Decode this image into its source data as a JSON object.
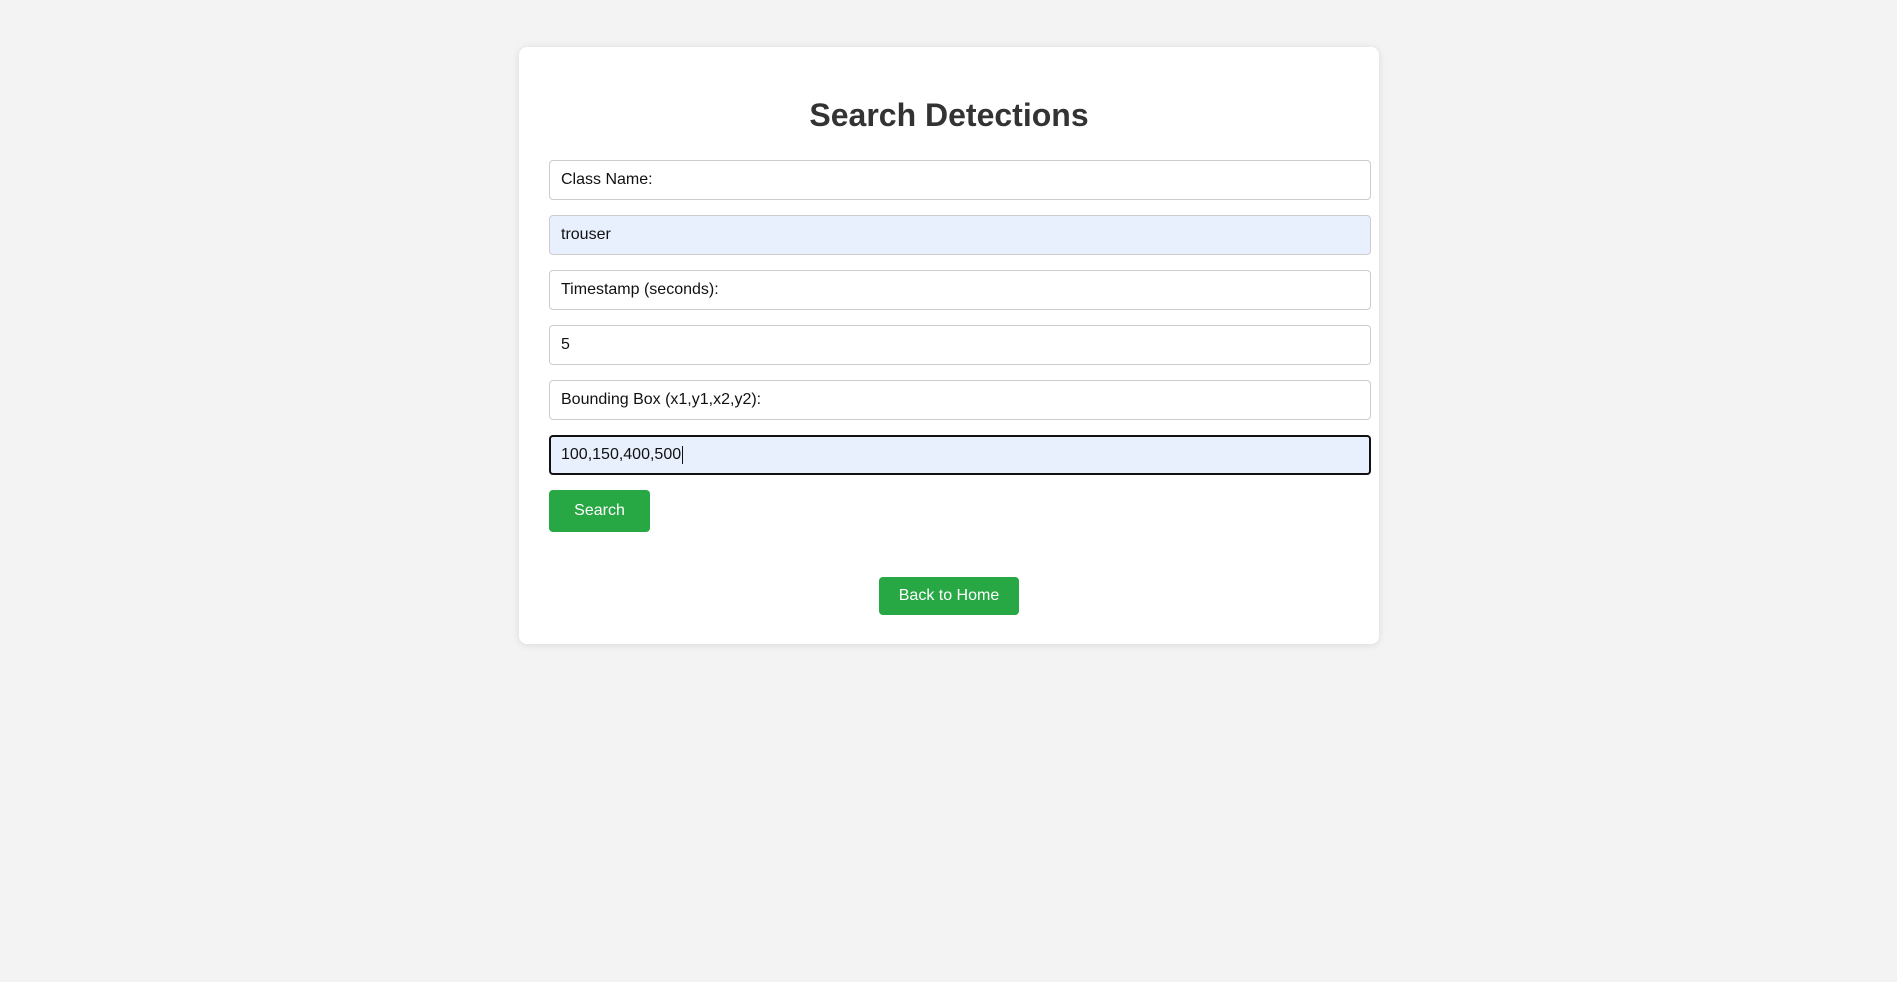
{
  "page": {
    "title": "Search Detections"
  },
  "form": {
    "class_name_label": "Class Name:",
    "class_name_value": "trouser",
    "timestamp_label": "Timestamp (seconds):",
    "timestamp_value": "5",
    "bbox_label": "Bounding Box (x1,y1,x2,y2):",
    "bbox_value": "100,150,400,500",
    "search_label": "Search"
  },
  "nav": {
    "back_label": "Back to Home"
  },
  "colors": {
    "background": "#f3f3f3",
    "card": "#ffffff",
    "button": "#28a745",
    "autofill": "#e8f0fe",
    "title_text": "#333333"
  }
}
